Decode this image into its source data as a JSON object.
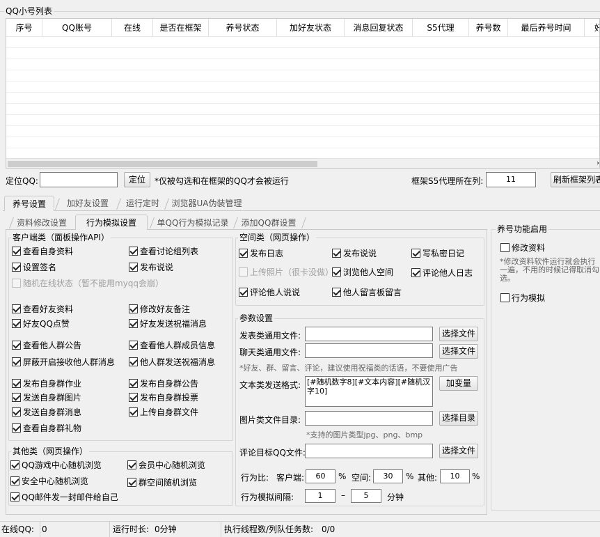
{
  "list_title": "QQ小号列表",
  "columns": [
    "序号",
    "QQ账号",
    "在线",
    "是否在框架",
    "养号状态",
    "加好友状态",
    "消息回复状态",
    "S5代理",
    "养号数",
    "最后养号时间",
    "好"
  ],
  "locate": {
    "label": "定位QQ:",
    "input_value": "",
    "button": "定位",
    "note": "*仅被勾选和在框架的QQ才会被运行",
    "proxy_label": "框架S5代理所在列:",
    "proxy_value": "11",
    "refresh_button": "刷新框架列表"
  },
  "main_tabs": [
    "养号设置",
    "加好友设置",
    "运行定时",
    "浏览器UA伪装管理"
  ],
  "sub_tabs": [
    "资料修改设置",
    "行为模拟设置",
    "单QQ行为模拟记录",
    "添加QQ群设置"
  ],
  "client": {
    "title": "客户端类（面板操作API）",
    "items": [
      {
        "label": "查看自身资料",
        "checked": true
      },
      {
        "label": "查看讨论组列表",
        "checked": true
      },
      {
        "label": "设置签名",
        "checked": true
      },
      {
        "label": "发布说说",
        "checked": true
      },
      {
        "label": "随机在线状态（暂不能用myqq会崩）",
        "checked": false,
        "disabled": true
      },
      {
        "label": "查看好友资料",
        "checked": true
      },
      {
        "label": "修改好友备注",
        "checked": true
      },
      {
        "label": "好友QQ点赞",
        "checked": true
      },
      {
        "label": "好友发送祝福消息",
        "checked": true
      },
      {
        "label": "查看他人群公告",
        "checked": true
      },
      {
        "label": "查看他人群成员信息",
        "checked": true
      },
      {
        "label": "屏蔽开启接收他人群消息",
        "checked": true
      },
      {
        "label": "他人群发送祝福消息",
        "checked": true
      },
      {
        "label": "发布自身群作业",
        "checked": true
      },
      {
        "label": "发布自身群公告",
        "checked": true
      },
      {
        "label": "发送自身群图片",
        "checked": true
      },
      {
        "label": "发布自身群投票",
        "checked": true
      },
      {
        "label": "发送自身群消息",
        "checked": true
      },
      {
        "label": "上传自身群文件",
        "checked": true
      },
      {
        "label": "查看自身群礼物",
        "checked": true
      }
    ]
  },
  "other": {
    "title": "其他类（网页操作）",
    "items": [
      {
        "label": "QQ游戏中心随机浏览",
        "checked": true
      },
      {
        "label": "会员中心随机浏览",
        "checked": true
      },
      {
        "label": "安全中心随机浏览",
        "checked": true
      },
      {
        "label": "群空间随机浏览",
        "checked": true
      },
      {
        "label": "QQ邮件发一封邮件给自己",
        "checked": true
      }
    ]
  },
  "space": {
    "title": "空间类（网页操作）",
    "items": [
      {
        "label": "发布日志",
        "checked": true
      },
      {
        "label": "发布说说",
        "checked": true
      },
      {
        "label": "写私密日记",
        "checked": true
      },
      {
        "label": "上传照片（很卡没做）",
        "checked": false,
        "disabled": true
      },
      {
        "label": "浏览他人空间",
        "checked": true
      },
      {
        "label": "评论他人日志",
        "checked": true
      },
      {
        "label": "评论他人说说",
        "checked": true
      },
      {
        "label": "他人留言板留言",
        "checked": true
      }
    ]
  },
  "params": {
    "title": "参数设置",
    "post_file_label": "发表类通用文件:",
    "post_file_value": "",
    "chat_file_label": "聊天类通用文件:",
    "chat_file_value": "",
    "choose_file": "选择文件",
    "note1": "*好友、群、留言、评论，建议使用祝福类的话语，不要使用广告",
    "text_format_label": "文本类发送格式:",
    "text_format_value": "[#随机数字8][#文本内容][#随机汉字10]",
    "add_var": "加变量",
    "image_dir_label": "图片类文件目录:",
    "image_dir_value": "",
    "choose_dir": "选择目录",
    "note2": "*支持的图片类型jpg、png、bmp",
    "comment_target_label": "评论目标QQ文件:",
    "comment_target_value": "",
    "ratio_label": "行为比:",
    "client_label": "客户端:",
    "client_value": "60",
    "space_label": "空间:",
    "space_value": "30",
    "other_label": "其他:",
    "other_value": "10",
    "percent": "%",
    "interval_label": "行为模拟间隔:",
    "interval_min": "1",
    "dash": "–",
    "interval_max": "5",
    "minute": "分钟"
  },
  "enable": {
    "title": "养号功能启用",
    "edit_profile": {
      "label": "修改资料",
      "checked": false
    },
    "note": "*修改资料软件运行就会执行一遍，不用的时候记得取消勾选。",
    "behavior": {
      "label": "行为模拟",
      "checked": false
    }
  },
  "status": {
    "online_label": "在线QQ:",
    "online_value": "0",
    "runtime_label": "运行时长:",
    "runtime_value": "0分钟",
    "threads_label": "执行线程数/列队任务数:",
    "threads_value": "0/0"
  }
}
